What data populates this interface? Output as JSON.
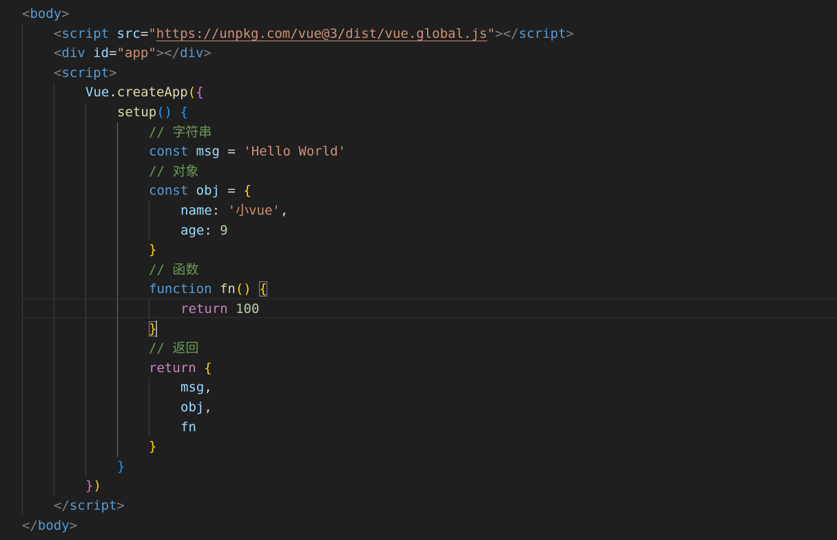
{
  "editor": {
    "language": "html",
    "theme": "dark",
    "cursor": {
      "line": 16,
      "column": 15
    },
    "lines": [
      {
        "indent": 0,
        "tokens": [
          {
            "t": "<",
            "c": "punc"
          },
          {
            "t": "body",
            "c": "tag"
          },
          {
            "t": ">",
            "c": "punc"
          }
        ]
      },
      {
        "indent": 1,
        "tokens": [
          {
            "t": "<",
            "c": "punc"
          },
          {
            "t": "script",
            "c": "tag"
          },
          {
            "t": " ",
            "c": "plain"
          },
          {
            "t": "src",
            "c": "attr"
          },
          {
            "t": "=",
            "c": "plain"
          },
          {
            "t": "\"",
            "c": "str"
          },
          {
            "t": "https://unpkg.com/vue@3/dist/vue.global.js",
            "c": "url"
          },
          {
            "t": "\"",
            "c": "str"
          },
          {
            "t": "></",
            "c": "punc"
          },
          {
            "t": "script",
            "c": "tag"
          },
          {
            "t": ">",
            "c": "punc"
          }
        ]
      },
      {
        "indent": 1,
        "tokens": [
          {
            "t": "<",
            "c": "punc"
          },
          {
            "t": "div",
            "c": "tag"
          },
          {
            "t": " ",
            "c": "plain"
          },
          {
            "t": "id",
            "c": "attr"
          },
          {
            "t": "=",
            "c": "plain"
          },
          {
            "t": "\"app\"",
            "c": "str"
          },
          {
            "t": "></",
            "c": "punc"
          },
          {
            "t": "div",
            "c": "tag"
          },
          {
            "t": ">",
            "c": "punc"
          }
        ]
      },
      {
        "indent": 1,
        "tokens": [
          {
            "t": "<",
            "c": "punc"
          },
          {
            "t": "script",
            "c": "tag"
          },
          {
            "t": ">",
            "c": "punc"
          }
        ]
      },
      {
        "indent": 2,
        "tokens": [
          {
            "t": "Vue",
            "c": "var"
          },
          {
            "t": ".",
            "c": "plain"
          },
          {
            "t": "createApp",
            "c": "fn"
          },
          {
            "t": "(",
            "c": "b1"
          },
          {
            "t": "{",
            "c": "b2"
          }
        ]
      },
      {
        "indent": 3,
        "tokens": [
          {
            "t": "setup",
            "c": "fn"
          },
          {
            "t": "()",
            "c": "b3"
          },
          {
            "t": " ",
            "c": "plain"
          },
          {
            "t": "{",
            "c": "b3"
          }
        ]
      },
      {
        "indent": 4,
        "tokens": [
          {
            "t": "// 字符串",
            "c": "cmt"
          }
        ]
      },
      {
        "indent": 4,
        "tokens": [
          {
            "t": "const",
            "c": "kw"
          },
          {
            "t": " ",
            "c": "plain"
          },
          {
            "t": "msg",
            "c": "var"
          },
          {
            "t": " = ",
            "c": "plain"
          },
          {
            "t": "'Hello World'",
            "c": "str"
          }
        ]
      },
      {
        "indent": 4,
        "tokens": [
          {
            "t": "// 对象",
            "c": "cmt"
          }
        ]
      },
      {
        "indent": 4,
        "tokens": [
          {
            "t": "const",
            "c": "kw"
          },
          {
            "t": " ",
            "c": "plain"
          },
          {
            "t": "obj",
            "c": "var"
          },
          {
            "t": " = ",
            "c": "plain"
          },
          {
            "t": "{",
            "c": "b1"
          }
        ]
      },
      {
        "indent": 5,
        "tokens": [
          {
            "t": "name",
            "c": "var"
          },
          {
            "t": ": ",
            "c": "plain"
          },
          {
            "t": "'小vue'",
            "c": "str"
          },
          {
            "t": ",",
            "c": "plain"
          }
        ]
      },
      {
        "indent": 5,
        "tokens": [
          {
            "t": "age",
            "c": "var"
          },
          {
            "t": ": ",
            "c": "plain"
          },
          {
            "t": "9",
            "c": "num"
          }
        ]
      },
      {
        "indent": 4,
        "tokens": [
          {
            "t": "}",
            "c": "b1"
          }
        ]
      },
      {
        "indent": 4,
        "tokens": [
          {
            "t": "// 函数",
            "c": "cmt"
          }
        ]
      },
      {
        "indent": 4,
        "tokens": [
          {
            "t": "function",
            "c": "kw"
          },
          {
            "t": " ",
            "c": "plain"
          },
          {
            "t": "fn",
            "c": "fn"
          },
          {
            "t": "()",
            "c": "b1"
          },
          {
            "t": " ",
            "c": "plain"
          },
          {
            "t": "{",
            "c": "b1",
            "match": true
          }
        ]
      },
      {
        "indent": 5,
        "tokens": [
          {
            "t": "return",
            "c": "ctrl"
          },
          {
            "t": " ",
            "c": "plain"
          },
          {
            "t": "100",
            "c": "num"
          }
        ]
      },
      {
        "indent": 4,
        "tokens": [
          {
            "t": "}",
            "c": "b1",
            "match": true
          }
        ]
      },
      {
        "indent": 4,
        "tokens": [
          {
            "t": "// 返回",
            "c": "cmt"
          }
        ]
      },
      {
        "indent": 4,
        "tokens": [
          {
            "t": "return",
            "c": "ctrl"
          },
          {
            "t": " ",
            "c": "plain"
          },
          {
            "t": "{",
            "c": "b1"
          }
        ]
      },
      {
        "indent": 5,
        "tokens": [
          {
            "t": "msg",
            "c": "var"
          },
          {
            "t": ",",
            "c": "plain"
          }
        ]
      },
      {
        "indent": 5,
        "tokens": [
          {
            "t": "obj",
            "c": "var"
          },
          {
            "t": ",",
            "c": "plain"
          }
        ]
      },
      {
        "indent": 5,
        "tokens": [
          {
            "t": "fn",
            "c": "var"
          }
        ]
      },
      {
        "indent": 4,
        "tokens": [
          {
            "t": "}",
            "c": "b1"
          }
        ]
      },
      {
        "indent": 3,
        "tokens": [
          {
            "t": "}",
            "c": "b3"
          }
        ]
      },
      {
        "indent": 2,
        "tokens": [
          {
            "t": "}",
            "c": "b2"
          },
          {
            "t": ")",
            "c": "b1"
          }
        ]
      },
      {
        "indent": 1,
        "tokens": [
          {
            "t": "</",
            "c": "punc"
          },
          {
            "t": "script",
            "c": "tag"
          },
          {
            "t": ">",
            "c": "punc"
          }
        ]
      },
      {
        "indent": 0,
        "tokens": [
          {
            "t": "</",
            "c": "punc"
          },
          {
            "t": "body",
            "c": "tag"
          },
          {
            "t": ">",
            "c": "punc"
          }
        ]
      }
    ]
  }
}
